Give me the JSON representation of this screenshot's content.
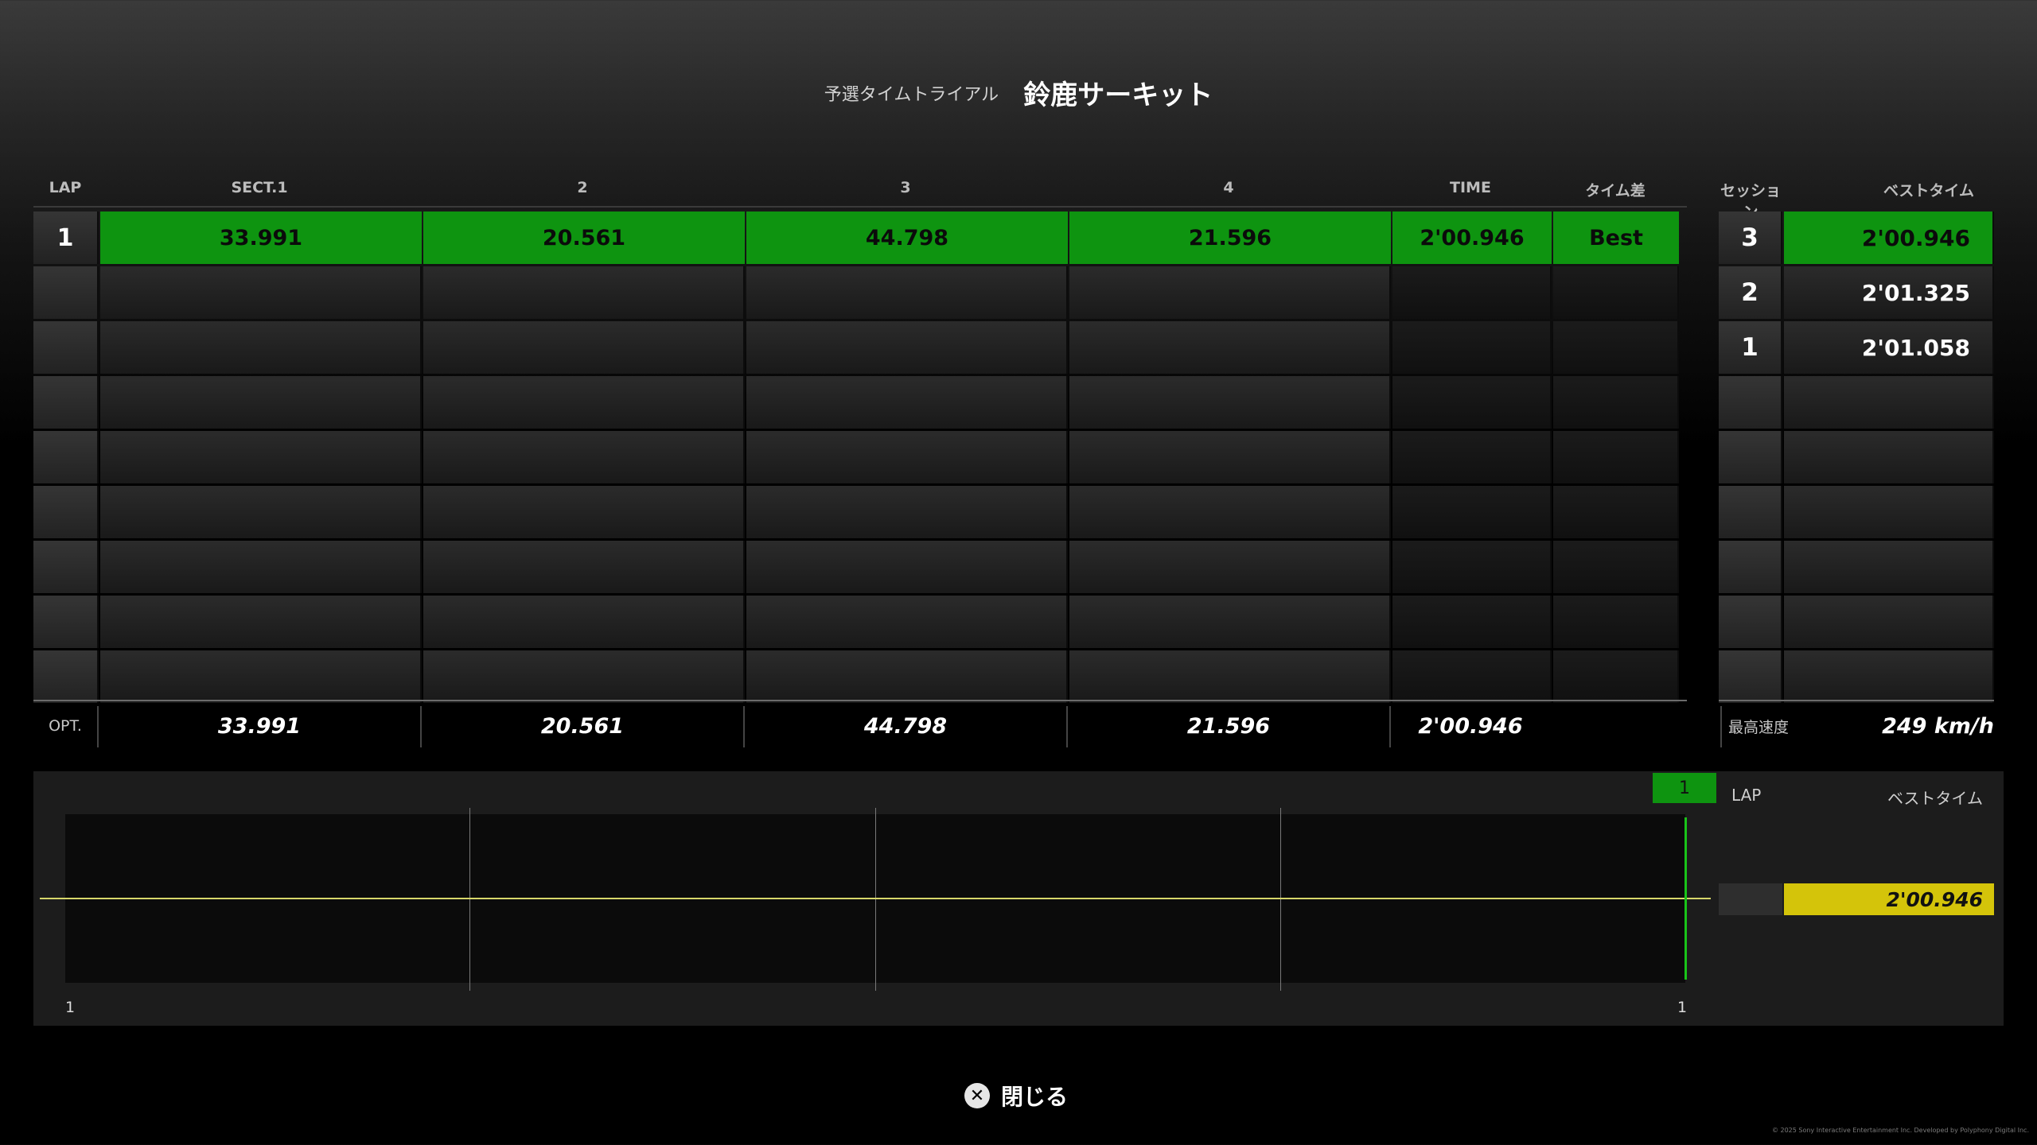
{
  "header": {
    "subtitle": "予選タイムトライアル",
    "circuit": "鈴鹿サーキット"
  },
  "columns": {
    "lap": "LAP",
    "sect1": "SECT.1",
    "sect2": "2",
    "sect3": "3",
    "sect4": "4",
    "time": "TIME",
    "diff": "タイム差",
    "session": "セッション",
    "best": "ベストタイム"
  },
  "laps": [
    {
      "lap": "1",
      "sectors": [
        "33.991",
        "20.561",
        "44.798",
        "21.596"
      ],
      "time": "2'00.946",
      "diff": "Best"
    }
  ],
  "optimal": {
    "label": "OPT.",
    "sectors": [
      "33.991",
      "20.561",
      "44.798",
      "21.596"
    ],
    "time": "2'00.946"
  },
  "sessions": [
    {
      "session": "3",
      "best": "2'00.946",
      "highlight": true
    },
    {
      "session": "2",
      "best": "2'01.325",
      "highlight": false
    },
    {
      "session": "1",
      "best": "2'01.058",
      "highlight": false
    }
  ],
  "top_speed": {
    "label": "最高速度",
    "value": "249 km/h"
  },
  "graph": {
    "badge": "1",
    "x_start": "1",
    "x_end": "1",
    "legend_lap": "LAP",
    "legend_best": "ベストタイム",
    "legend_value": "2'00.946",
    "line_color": "#d7d76a",
    "marker_color": "#19c419"
  },
  "colors": {
    "best_green": "#0e9410",
    "chart_yellow": "#d4c40a"
  },
  "footer": {
    "close_icon": "cross-button-icon",
    "close_label": "閉じる",
    "copyright": "© 2025 Sony Interactive Entertainment Inc. Developed by Polyphony Digital Inc."
  }
}
